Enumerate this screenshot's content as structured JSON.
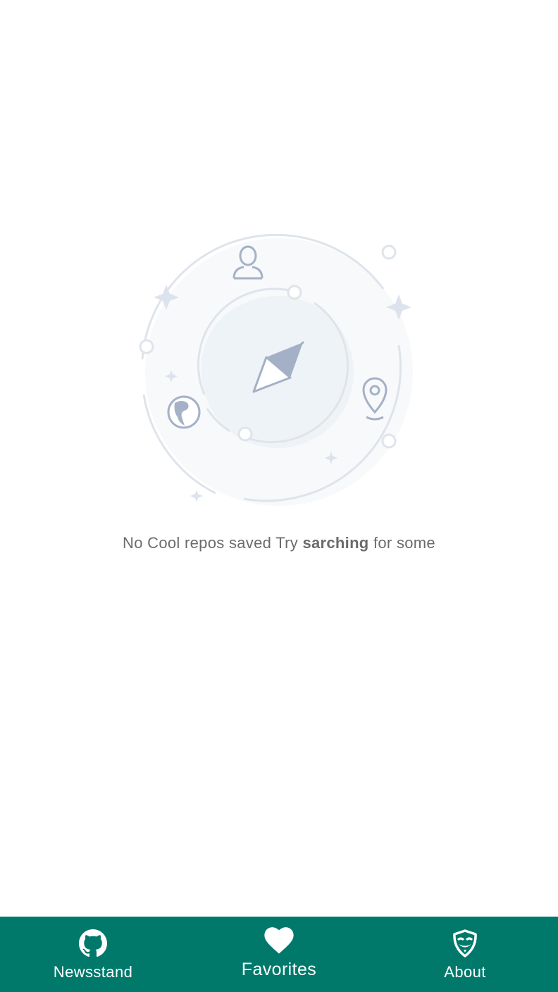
{
  "empty_state": {
    "message_before": "No Cool repos saved Try ",
    "message_emphasis": "sarching",
    "message_after": " for some"
  },
  "tab_bar": {
    "background_color": "#00796b",
    "tabs": [
      {
        "label": "Newsstand",
        "icon": "github-icon",
        "active": false
      },
      {
        "label": "Favorites",
        "icon": "heart-icon",
        "active": true
      },
      {
        "label": "About",
        "icon": "mask-icon",
        "active": false
      }
    ]
  }
}
